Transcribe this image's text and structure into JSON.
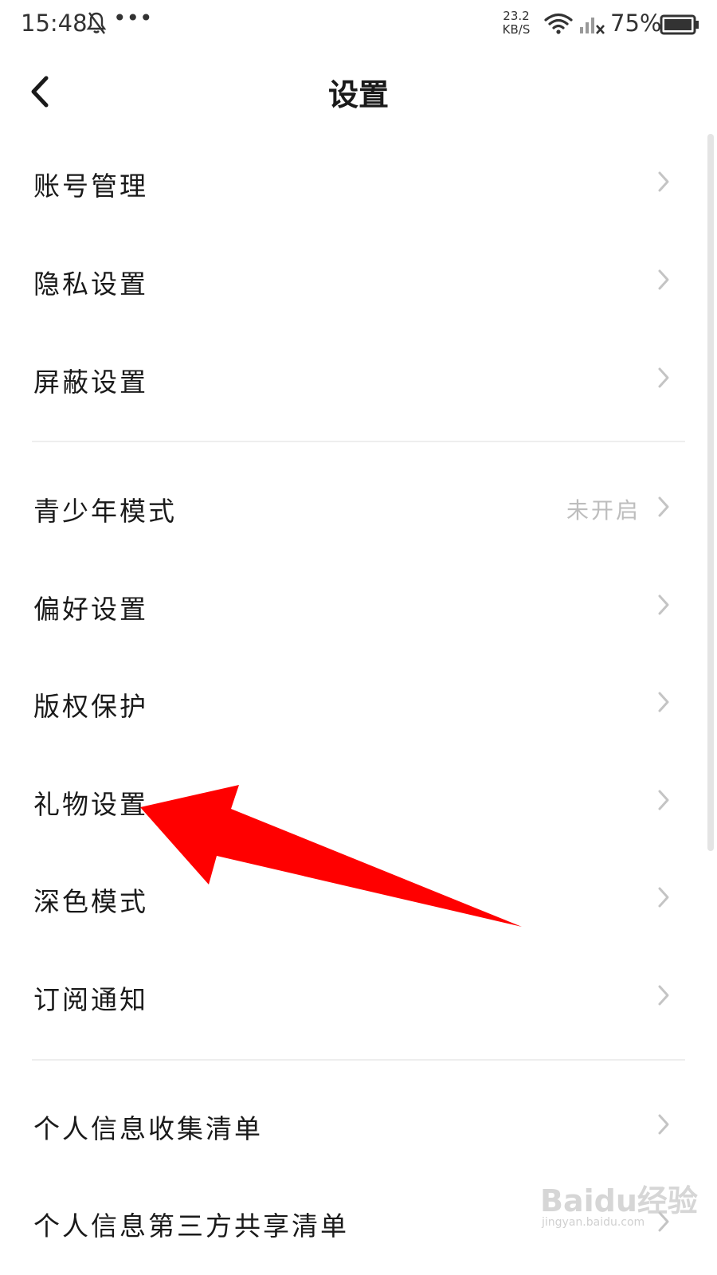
{
  "status_bar": {
    "time": "15:48",
    "more": "•••",
    "net_speed_value": "23.2",
    "net_speed_unit": "KB/S",
    "battery": "75%"
  },
  "header": {
    "title": "设置"
  },
  "menu": [
    {
      "label": "账号管理",
      "status": ""
    },
    {
      "label": "隐私设置",
      "status": ""
    },
    {
      "label": "屏蔽设置",
      "status": ""
    },
    {
      "label": "青少年模式",
      "status": "未开启"
    },
    {
      "label": "偏好设置",
      "status": ""
    },
    {
      "label": "版权保护",
      "status": ""
    },
    {
      "label": "礼物设置",
      "status": ""
    },
    {
      "label": "深色模式",
      "status": ""
    },
    {
      "label": "订阅通知",
      "status": ""
    },
    {
      "label": "个人信息收集清单",
      "status": ""
    },
    {
      "label": "个人信息第三方共享清单",
      "status": ""
    }
  ],
  "watermark": {
    "brand": "Baidu经验",
    "url": "jingyan.baidu.com"
  },
  "colors": {
    "annotation_arrow": "#ff0000",
    "status_text": "#bdbdbd",
    "chevron": "#c4c4c4"
  }
}
